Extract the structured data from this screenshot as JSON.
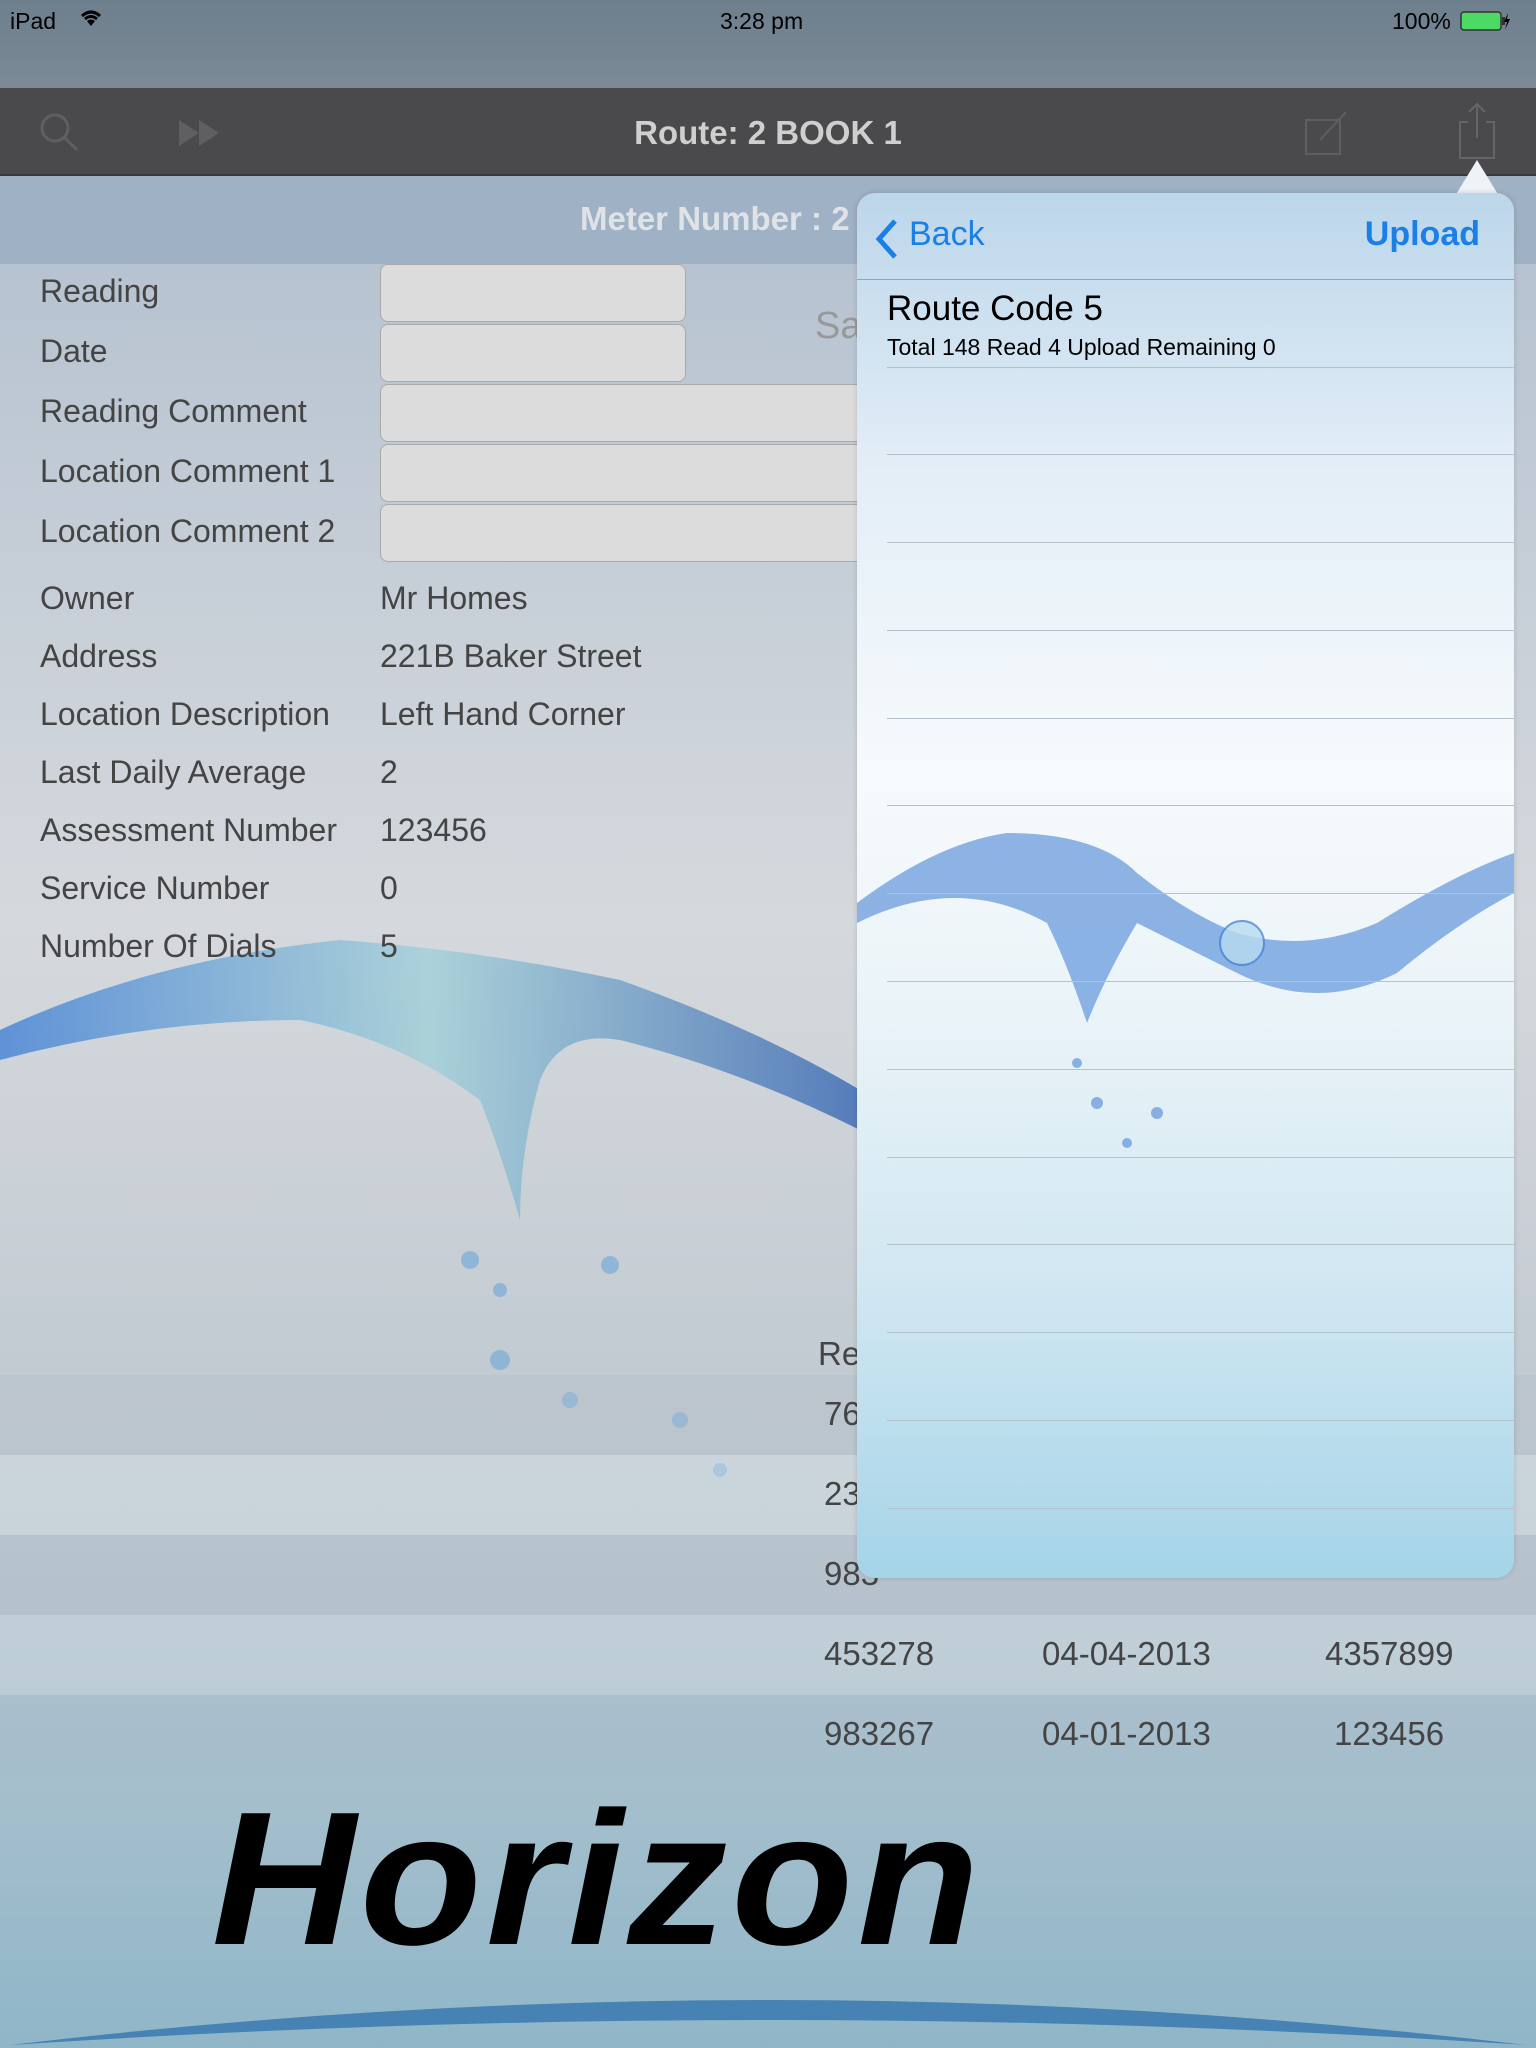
{
  "status_bar": {
    "device": "iPad",
    "time": "3:28 pm",
    "battery": "100%"
  },
  "nav": {
    "title": "Route:  2   BOOK 1",
    "icons": [
      "search-icon",
      "fast-forward-icon",
      "compose-icon",
      "share-icon"
    ]
  },
  "meter": {
    "label": "Meter Number :  2"
  },
  "form": {
    "fields": [
      {
        "label": "Reading",
        "value": ""
      },
      {
        "label": "Date",
        "value": ""
      },
      {
        "label": "Reading Comment",
        "value": ""
      },
      {
        "label": "Location Comment 1",
        "value": ""
      },
      {
        "label": "Location Comment 2",
        "value": ""
      }
    ],
    "save_label": "Sa"
  },
  "details": [
    {
      "label": "Owner",
      "value": "Mr Homes"
    },
    {
      "label": "Address",
      "value": "221B Baker Street"
    },
    {
      "label": "Location Description",
      "value": "Left Hand Corner"
    },
    {
      "label": "Last Daily Average",
      "value": "2"
    },
    {
      "label": "Assessment Number",
      "value": "123456"
    },
    {
      "label": "Service Number",
      "value": "0"
    },
    {
      "label": "Number Of Dials",
      "value": "5"
    }
  ],
  "history": {
    "header": "Re",
    "rows": [
      {
        "reading": "76",
        "date": "",
        "value": ""
      },
      {
        "reading": "23",
        "date": "",
        "value": ""
      },
      {
        "reading": "983",
        "date": "",
        "value": ""
      },
      {
        "reading": "453278",
        "date": "04-04-2013",
        "value": "4357899"
      },
      {
        "reading": "983267",
        "date": "04-01-2013",
        "value": "123456"
      }
    ]
  },
  "popover": {
    "back_label": "Back",
    "upload_label": "Upload",
    "route_title": "Route Code 5",
    "route_summary": "Total 148 Read 4 Upload Remaining 0"
  },
  "logo": {
    "text": "Horizon",
    "accent": "#4682b4"
  },
  "colors": {
    "ios_blue": "#1a7fe6",
    "navbar": "#4a4a4c",
    "battery": "#4cd964"
  }
}
